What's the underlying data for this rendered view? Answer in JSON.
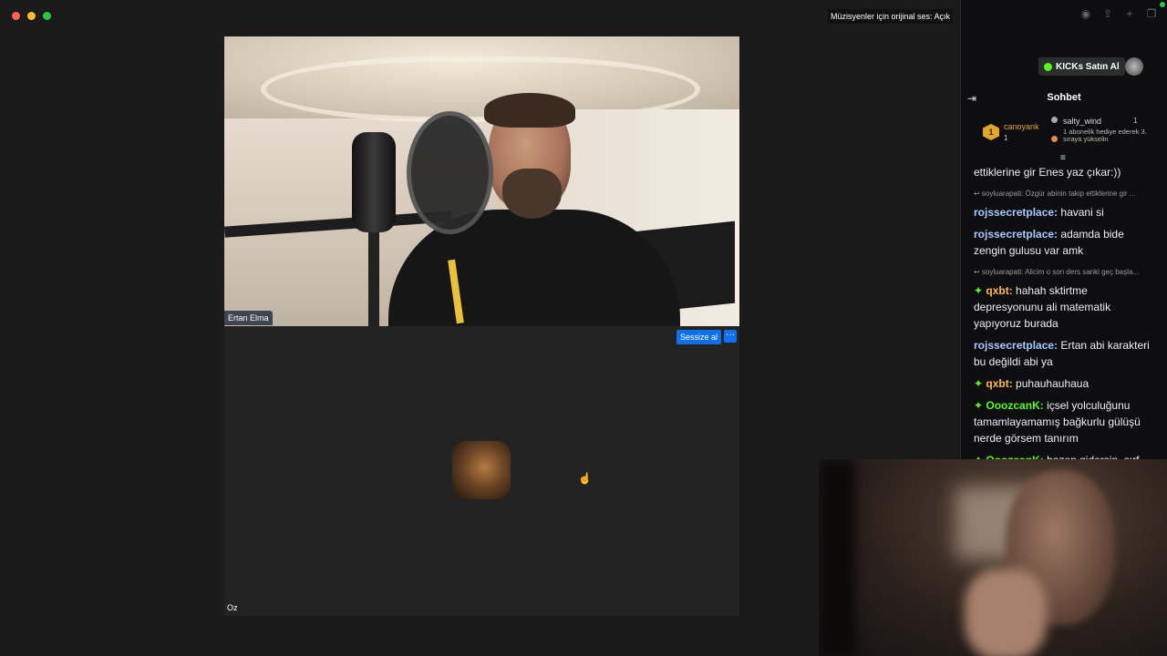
{
  "zoom": {
    "original_sound": "Müzisyenler için orijinal ses: Açık",
    "top_participant": "Ertan Elma",
    "mute_button": "Sessize al",
    "more_button": "···",
    "bottom_participant": "Oz"
  },
  "kick": {
    "kicks_button": "KICKs Satın Al",
    "chat_title": "Sohbet",
    "leaderboard": {
      "first_rank": "1",
      "first_name": "canoyank",
      "first_count": "1",
      "second_name": "salty_wind",
      "second_count": "1",
      "second_detail": "1 abonelik hediye ederek 3. sıraya yükselin"
    },
    "messages": [
      {
        "reply": "",
        "user": "",
        "text": "ettiklerine gir Enes yaz çıkar:))",
        "user_color": "#efeff1",
        "badge": false
      },
      {
        "reply": "soyluarapati: Özgür abinin takip ettiklerine gir ...",
        "user": "rojssecretplace:",
        "text": " havani si",
        "user_color": "#a8c8ff",
        "badge": false
      },
      {
        "reply": "",
        "user": "rojssecretplace:",
        "text": " adamda bide zengin gulusu var amk",
        "user_color": "#a8c8ff",
        "badge": false
      },
      {
        "reply": "soyluarapati: Alicim o son ders sanki geç başla...",
        "user": "qxbt:",
        "text": " hahah sktirtme depresyonunu ali matematik yapıyoruz burada",
        "user_color": "#ffb84d",
        "badge": true
      },
      {
        "reply": "",
        "user": "rojssecretplace:",
        "text": " Ertan abi karakteri bu değildi abi ya",
        "user_color": "#a8c8ff",
        "badge": false
      },
      {
        "reply": "",
        "user": "qxbt:",
        "text": " puhauhauhaua",
        "user_color": "#ffb84d",
        "badge": true
      },
      {
        "reply": "",
        "user": "OoozcanK:",
        "text": " içsel yolculuğunu tamamlayamamış bağkurlu gülüşü nerde görsem tanırım",
        "user_color": "#53fc18",
        "badge": true
      },
      {
        "reply": "",
        "user": "OoozcanK:",
        "text": " bazen gidersin, sırf",
        "user_color": "#53fc18",
        "badge": true
      }
    ]
  },
  "colors": {
    "kick_green": "#53fc18",
    "zoom_blue": "#0e71eb"
  }
}
